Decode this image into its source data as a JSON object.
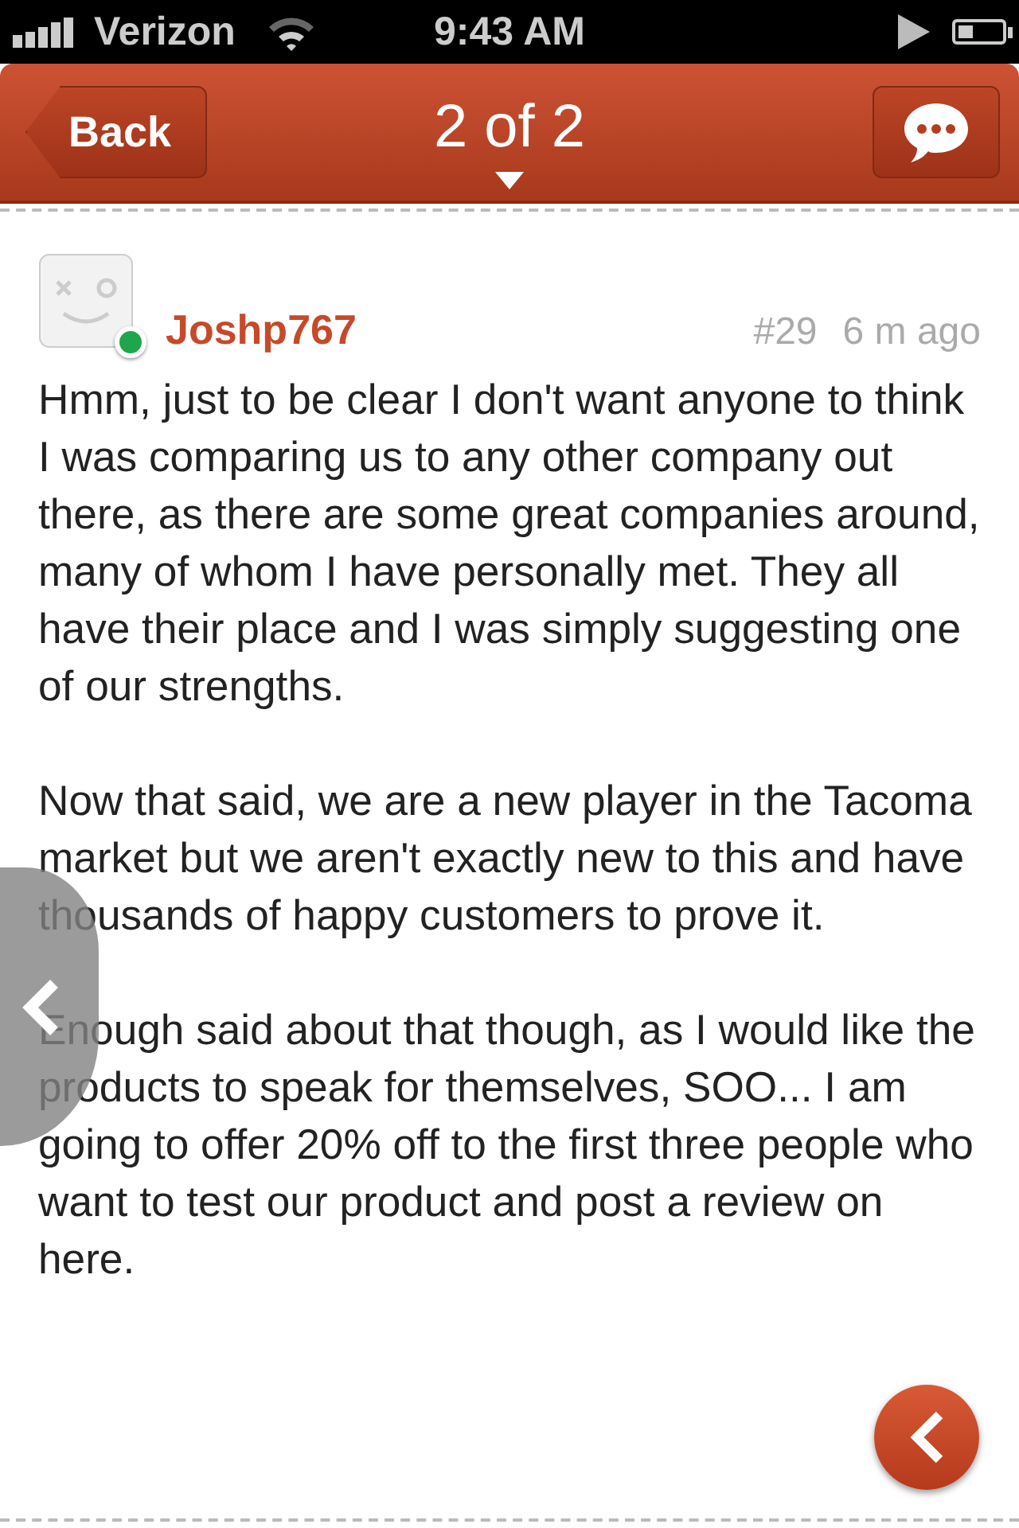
{
  "status_bar": {
    "carrier": "Verizon",
    "time": "9:43 AM"
  },
  "nav_bar": {
    "back": "Back",
    "title": "2 of 2"
  },
  "post": {
    "author": "Joshp767",
    "online": true,
    "number": "#29",
    "time": "6 m ago",
    "paragraphs": [
      "Hmm, just to be clear I don't want anyone to think I was comparing us to any other company out there, as there are some great companies around, many of whom I have personally met. They all have their place and I was simply suggesting one of our strengths.",
      "Now that said, we are a new player in the Tacoma market but we aren't exactly new to this and have thousands of happy customers to prove it.",
      "Enough said about that though, as I would like the products to speak for themselves, SOO... I am going to offer 20% off to the first three people who want to test our product and post a review on here."
    ]
  }
}
